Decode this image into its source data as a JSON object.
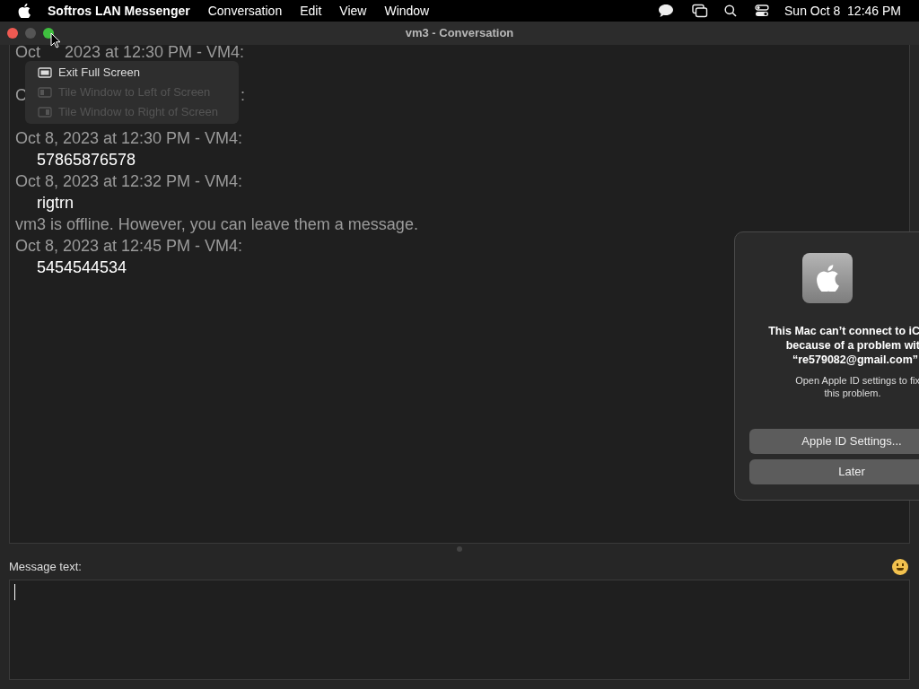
{
  "menu_bar": {
    "app": "Softros LAN Messenger",
    "items": [
      "Conversation",
      "Edit",
      "View",
      "Window"
    ],
    "clock": "Sun Oct 8  12:46 PM"
  },
  "window": {
    "title": "vm3 - Conversation"
  },
  "messages": [
    {
      "kind": "partial_top",
      "parts": [
        "Oct",
        "2023 at 12:30 PM - VM4:"
      ]
    },
    {
      "kind": "spacer"
    },
    {
      "kind": "partial_side",
      "parts": [
        "C",
        ":"
      ]
    },
    {
      "kind": "spacer"
    },
    {
      "kind": "header",
      "text": "Oct 8, 2023 at 12:30 PM - VM4:"
    },
    {
      "kind": "body",
      "text": "57865876578"
    },
    {
      "kind": "header",
      "text": "Oct 8, 2023 at 12:32 PM - VM4:"
    },
    {
      "kind": "body",
      "text": "rigtrn"
    },
    {
      "kind": "notice",
      "text": "vm3 is offline. However, you can leave them a message."
    },
    {
      "kind": "header",
      "text": "Oct 8, 2023 at 12:45 PM - VM4:"
    },
    {
      "kind": "body",
      "text": "5454544534"
    }
  ],
  "popup_menu": [
    {
      "label": "Exit Full Screen",
      "disabled": false
    },
    {
      "label": "Tile Window to Left of Screen",
      "disabled": true
    },
    {
      "label": "Tile Window to Right of Screen",
      "disabled": true
    }
  ],
  "compose": {
    "label": "Message text:"
  },
  "dialog": {
    "title_lines": [
      "This Mac can’t connect to iC",
      "because of a problem wit",
      "“re579082@gmail.com”"
    ],
    "body_lines": [
      "Open Apple ID settings to fix",
      "this problem."
    ],
    "buttons": [
      "Apple ID Settings...",
      "Later"
    ]
  }
}
